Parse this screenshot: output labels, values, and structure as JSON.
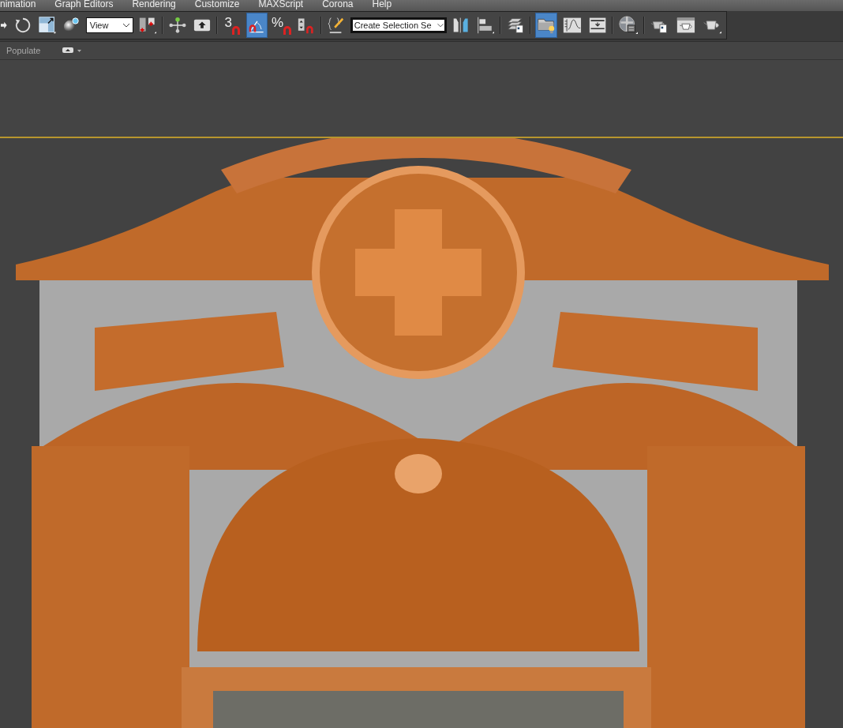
{
  "menu_bar": {
    "items": [
      "nimation",
      "Graph Editors",
      "Rendering",
      "Customize",
      "MAXScript",
      "Corona",
      "Help"
    ]
  },
  "main_toolbar": {
    "items": [
      {
        "kind": "arrow",
        "selected": false
      },
      {
        "kind": "rotate",
        "selected": false
      },
      {
        "kind": "scale",
        "selected": false
      },
      {
        "kind": "sphere",
        "selected": false
      },
      {
        "kind": "dropdown",
        "value": "View"
      },
      {
        "kind": "placement",
        "selected": false
      },
      {
        "kind": "separator"
      },
      {
        "kind": "pivot",
        "selected": false
      },
      {
        "kind": "push",
        "selected": false
      },
      {
        "kind": "separator"
      },
      {
        "kind": "snap",
        "label": "3",
        "selected": false
      },
      {
        "kind": "angle",
        "selected": true
      },
      {
        "kind": "snap",
        "label": "%",
        "selected": false
      },
      {
        "kind": "spinner",
        "selected": false
      },
      {
        "kind": "separator"
      },
      {
        "kind": "named",
        "selected": false
      },
      {
        "kind": "dropdown",
        "value": "Create Selection Se"
      },
      {
        "kind": "mirror",
        "selected": false
      },
      {
        "kind": "align",
        "selected": false
      },
      {
        "kind": "separator"
      },
      {
        "kind": "layers",
        "selected": false
      },
      {
        "kind": "separator"
      },
      {
        "kind": "explorer",
        "selected": true
      },
      {
        "kind": "curve",
        "selected": false
      },
      {
        "kind": "schematic",
        "selected": false
      },
      {
        "kind": "separator"
      },
      {
        "kind": "material",
        "selected": false
      },
      {
        "kind": "separator"
      },
      {
        "kind": "rendersetup",
        "selected": false
      },
      {
        "kind": "frame",
        "selected": false
      },
      {
        "kind": "render",
        "selected": false
      }
    ]
  },
  "ribbon": {
    "tab": "Populate"
  }
}
